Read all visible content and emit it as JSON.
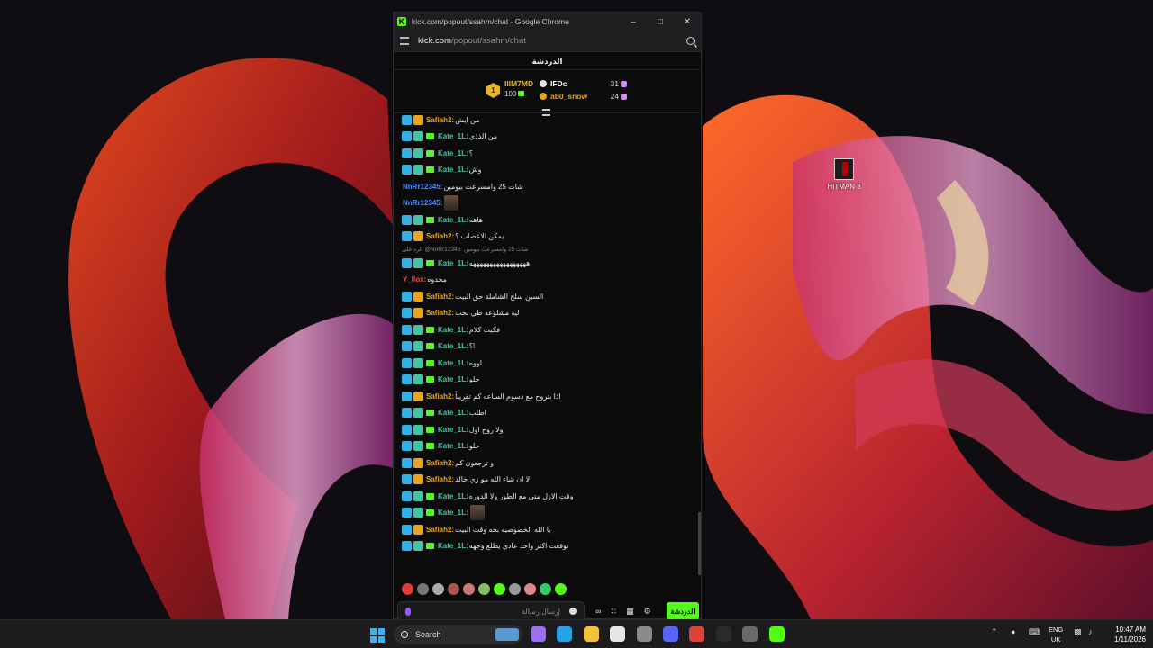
{
  "window": {
    "title": "kick.com/popout/ssahm/chat - Google Chrome",
    "url_host": "kick.com",
    "url_path": "/popout/ssahm/chat"
  },
  "desktop_icon": {
    "label": "HITMAN 3"
  },
  "chat": {
    "header": "الدردشة",
    "leaderboard": {
      "rank": "1",
      "top_name": "IIIM7MD",
      "top_value": "100",
      "entries": [
        {
          "name": "IFDc",
          "count": "31",
          "color": "#ffffff"
        },
        {
          "name": "ab0_snow",
          "count": "24",
          "color": "#e9a61b"
        }
      ]
    },
    "messages": [
      {
        "user": "Safiah2:",
        "text": "من ايش",
        "badges": [
          "og",
          "crown"
        ],
        "color": "#e9a61b"
      },
      {
        "user": "Kate_1L:",
        "text": "من الذذي",
        "badges": [
          "og",
          "sub",
          "gift"
        ],
        "color": "#3ec6a5"
      },
      {
        "user": "Kate_1L:",
        "text": "؟",
        "badges": [
          "og",
          "sub",
          "gift"
        ],
        "color": "#3ec6a5"
      },
      {
        "user": "Kate_1L:",
        "text": "وش",
        "badges": [
          "og",
          "sub",
          "gift"
        ],
        "color": "#3ec6a5"
      },
      {
        "user": "NnRr12345:",
        "text": "شات 25 وامسرعت بيومين",
        "badges": [],
        "color": "#4f8bff"
      },
      {
        "user": "NnRr12345:",
        "text": "",
        "badges": [],
        "color": "#4f8bff",
        "emote": true
      },
      {
        "user": "Kate_1L:",
        "text": "هاهه",
        "badges": [
          "og",
          "sub",
          "gift"
        ],
        "color": "#3ec6a5"
      },
      {
        "user": "Safiah2:",
        "text": "يمكن الاعصاب ؟",
        "badges": [
          "og",
          "crown"
        ],
        "color": "#e9a61b"
      },
      {
        "user": "Kate_1L:",
        "text": "هههههههههههههههههه",
        "badges": [
          "og",
          "sub",
          "gift"
        ],
        "color": "#3ec6a5",
        "reply": "الرد على @NnRr12345: شات 25 وامسرعت بيومين"
      },
      {
        "user": "Y_llox:",
        "text": "مخدوه",
        "badges": [],
        "color": "#ff4d4d"
      },
      {
        "user": "Safiah2:",
        "text": "السين سلح الشاملة حق البيت",
        "badges": [
          "og",
          "crown"
        ],
        "color": "#e9a61b"
      },
      {
        "user": "Safiah2:",
        "text": "ليه مشلوعه طي بحب",
        "badges": [
          "og",
          "crown"
        ],
        "color": "#e9a61b"
      },
      {
        "user": "Kate_1L:",
        "text": "فكيت كلام",
        "badges": [
          "og",
          "sub",
          "gift"
        ],
        "color": "#3ec6a5"
      },
      {
        "user": "Kate_1L:",
        "text": "؟!",
        "badges": [
          "og",
          "sub",
          "gift"
        ],
        "color": "#3ec6a5"
      },
      {
        "user": "Kate_1L:",
        "text": "اووه",
        "badges": [
          "og",
          "sub",
          "gift"
        ],
        "color": "#3ec6a5"
      },
      {
        "user": "Kate_1L:",
        "text": "حلو",
        "badges": [
          "og",
          "sub",
          "gift"
        ],
        "color": "#3ec6a5"
      },
      {
        "user": "Safiah2:",
        "text": "اذا بتروح مع دسوم الساعه كم تقريباً",
        "badges": [
          "og",
          "crown"
        ],
        "color": "#e9a61b"
      },
      {
        "user": "Kate_1L:",
        "text": "اطلب",
        "badges": [
          "og",
          "sub",
          "gift"
        ],
        "color": "#3ec6a5"
      },
      {
        "user": "Kate_1L:",
        "text": "ولا روح اول",
        "badges": [
          "og",
          "sub",
          "gift"
        ],
        "color": "#3ec6a5"
      },
      {
        "user": "Kate_1L:",
        "text": "حلو",
        "badges": [
          "og",
          "sub",
          "gift"
        ],
        "color": "#3ec6a5"
      },
      {
        "user": "Safiah2:",
        "text": "و ترجعون كم",
        "badges": [
          "og",
          "crown"
        ],
        "color": "#e9a61b"
      },
      {
        "user": "Safiah2:",
        "text": "لا ان شاء الله مو زي خالد",
        "badges": [
          "og",
          "crown"
        ],
        "color": "#e9a61b"
      },
      {
        "user": "Kate_1L:",
        "text": "وقت الازل متى مع الطور ولا الدوره",
        "badges": [
          "og",
          "sub",
          "gift"
        ],
        "color": "#3ec6a5"
      },
      {
        "user": "Kate_1L:",
        "text": "",
        "badges": [
          "og",
          "sub",
          "gift"
        ],
        "color": "#3ec6a5",
        "emote": true
      },
      {
        "user": "Safiah2:",
        "text": "يا الله الخصوصيه بحه وقت البيت",
        "badges": [
          "og",
          "crown"
        ],
        "color": "#e9a61b"
      },
      {
        "user": "Kate_1L:",
        "text": "توقعت اكثر واحد عادي يطلع وجهه",
        "badges": [
          "og",
          "sub",
          "gift"
        ],
        "color": "#3ec6a5"
      }
    ],
    "emote_bar_colors": [
      "#e23b3b",
      "#777",
      "#aaa",
      "#a55",
      "#c77",
      "#8b6",
      "#53fc18",
      "#999",
      "#d88",
      "#3c6",
      "#53fc18"
    ],
    "input": {
      "placeholder": "إرسال رسالة"
    },
    "send_label": "الدردشة"
  },
  "taskbar": {
    "search_label": "Search",
    "lang_line1": "ENG",
    "lang_line2": "UK",
    "time": "10:47 AM",
    "date": "1/11/2026",
    "apps": [
      {
        "name": "copilot-icon",
        "color": "#9b6ff0"
      },
      {
        "name": "edge-icon",
        "color": "#2aa0e6"
      },
      {
        "name": "file-explorer-icon",
        "color": "#f3c23c"
      },
      {
        "name": "store-icon",
        "color": "#e7e7e7"
      },
      {
        "name": "settings-icon",
        "color": "#8a8a8a"
      },
      {
        "name": "discord-icon",
        "color": "#5865f2"
      },
      {
        "name": "chrome-icon",
        "color": "#db4437"
      },
      {
        "name": "epic-games-icon",
        "color": "#2a2a2a"
      },
      {
        "name": "steam-icon",
        "color": "#6b6b6b"
      },
      {
        "name": "kick-icon",
        "color": "#53fc18"
      }
    ]
  }
}
